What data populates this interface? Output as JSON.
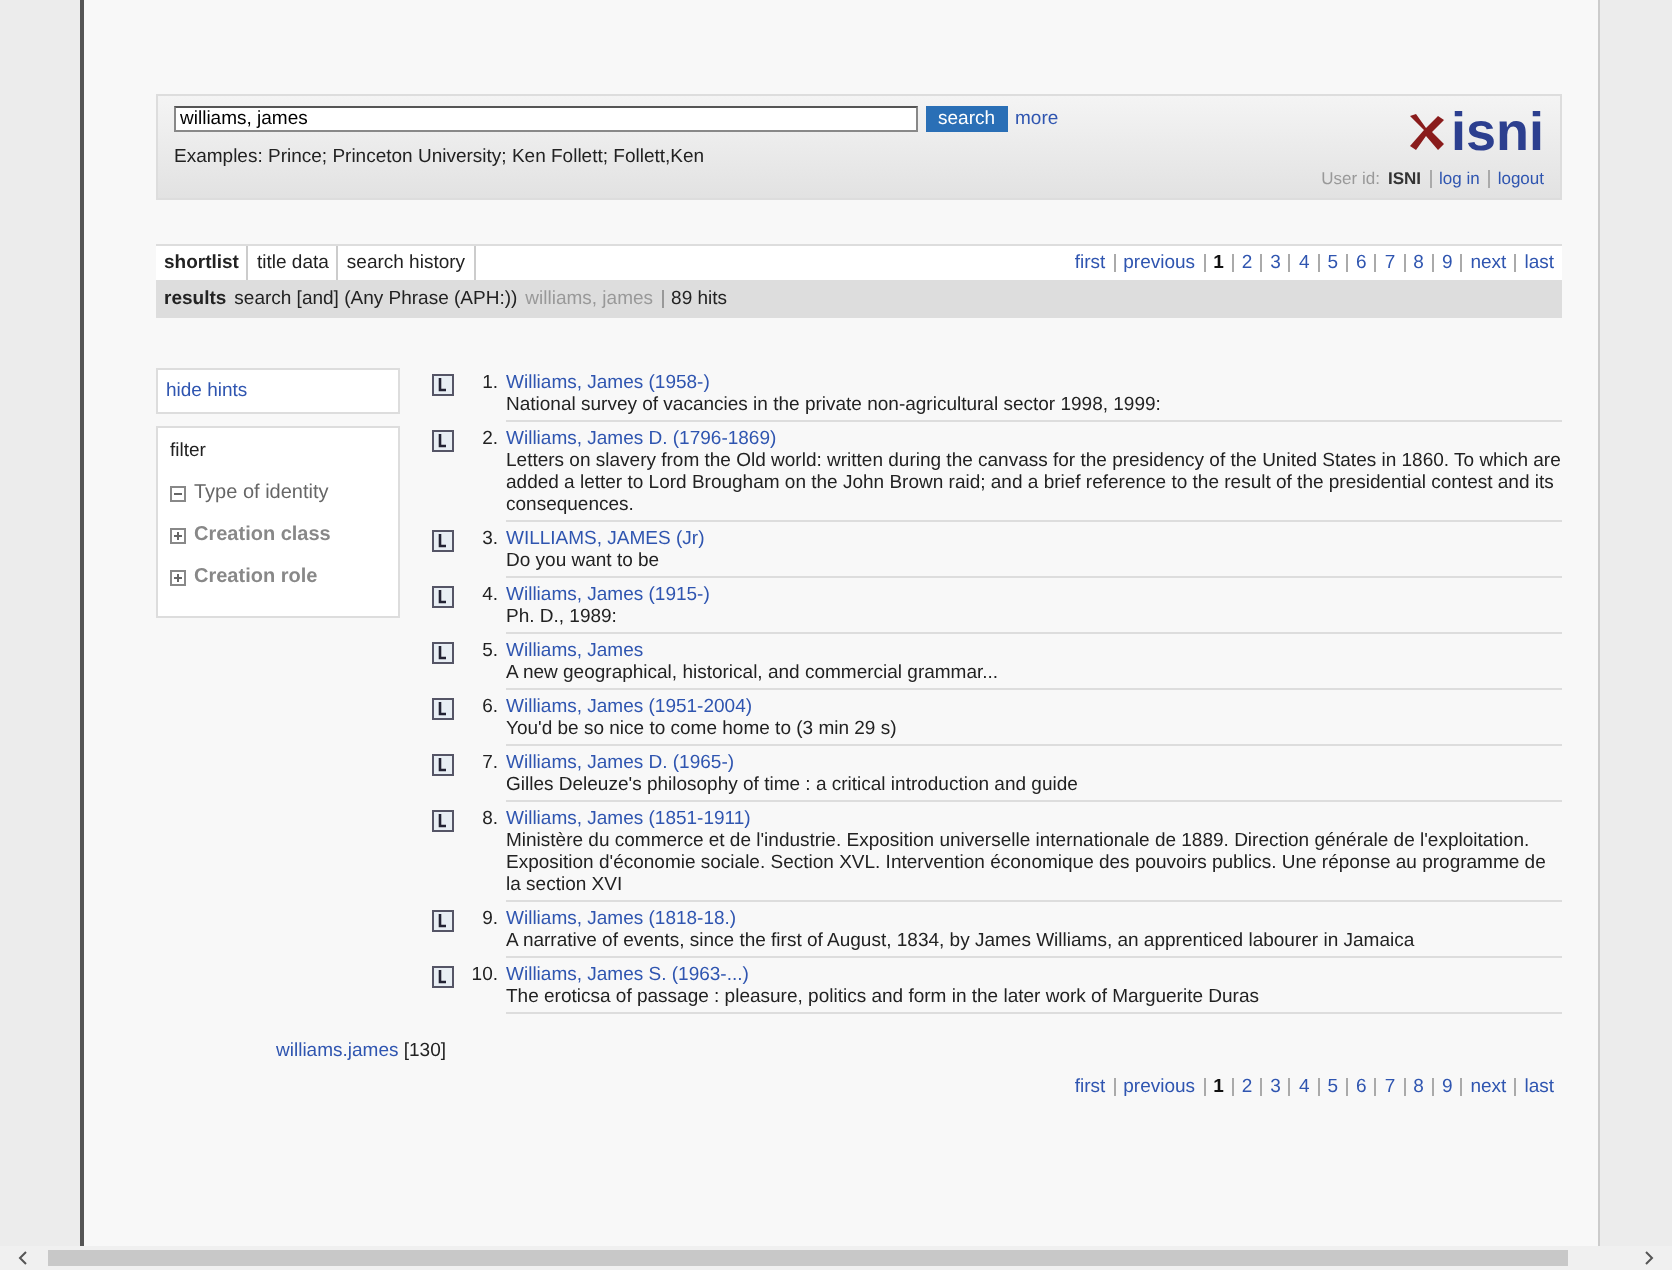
{
  "search": {
    "value": "williams, james",
    "button": "search",
    "more": "more",
    "examples": "Examples: Prince; Princeton University; Ken Follett; Follett,Ken"
  },
  "logo": {
    "text": "isni"
  },
  "user": {
    "label": "User id:",
    "id": "ISNI",
    "login": "log in",
    "logout": "logout"
  },
  "tabs": [
    {
      "label": "shortlist",
      "selected": true
    },
    {
      "label": "title data",
      "selected": false
    },
    {
      "label": "search history",
      "selected": false
    }
  ],
  "pager_top": [
    {
      "label": "first",
      "selected": false
    },
    {
      "label": "previous",
      "selected": false
    },
    {
      "label": "1",
      "selected": true
    },
    {
      "label": "2",
      "selected": false
    },
    {
      "label": "3",
      "selected": false
    },
    {
      "label": "4",
      "selected": false
    },
    {
      "label": "5",
      "selected": false
    },
    {
      "label": "6",
      "selected": false
    },
    {
      "label": "7",
      "selected": false
    },
    {
      "label": "8",
      "selected": false
    },
    {
      "label": "9",
      "selected": false
    },
    {
      "label": "next",
      "selected": false
    },
    {
      "label": "last",
      "selected": false
    }
  ],
  "results_bar": {
    "label": "results",
    "query": "search [and] (Any Phrase (APH:))",
    "term": "williams, james",
    "hits": "89 hits"
  },
  "sidebar": {
    "hide_hints": "hide hints",
    "filter_title": "filter",
    "filters": [
      {
        "label": "Type of identity",
        "expanded": true
      },
      {
        "label": "Creation class",
        "expanded": false
      },
      {
        "label": "Creation role",
        "expanded": false
      }
    ]
  },
  "results": [
    {
      "number": "1.",
      "name": "Williams, James (1958-)",
      "title": "National survey of vacancies in the private non-agricultural sector 1998, 1999:"
    },
    {
      "number": "2.",
      "name": "Williams, James D. (1796-1869)",
      "title": "Letters on slavery from the Old world: written during the canvass for the presidency of the United States in 1860. To which are added a letter to Lord Brougham on the John Brown raid; and a brief reference to the result of the presidential contest and its consequences."
    },
    {
      "number": "3.",
      "name": "WILLIAMS, JAMES (Jr)",
      "title": "Do you want to be"
    },
    {
      "number": "4.",
      "name": "Williams, James (1915-)",
      "title": "Ph. D., 1989:"
    },
    {
      "number": "5.",
      "name": "Williams, James",
      "title": "A new geographical, historical, and commercial grammar..."
    },
    {
      "number": "6.",
      "name": "Williams, James (1951-2004)",
      "title": "You'd be so nice to come home to (3 min 29 s)"
    },
    {
      "number": "7.",
      "name": "Williams, James D. (1965-)",
      "title": "Gilles Deleuze's philosophy of time : a critical introduction and guide"
    },
    {
      "number": "8.",
      "name": "Williams, James (1851-1911)",
      "title": "Ministère du commerce et de l'industrie. Exposition universelle internationale de 1889. Direction générale de l'exploitation. Exposition d'économie sociale. Section XVL. Intervention économique des pouvoirs publics. Une réponse au programme de la section XVI"
    },
    {
      "number": "9.",
      "name": "Williams, James (1818-18.)",
      "title": "A narrative of events, since the first of August, 1834, by James Williams, an apprenticed labourer in Jamaica"
    },
    {
      "number": "10.",
      "name": "Williams, James S. (1963-...)",
      "title": "The eroticsa of passage : pleasure, politics and form in the later work of Marguerite Duras"
    }
  ],
  "related": {
    "link": "williams.james",
    "count": "[130]"
  },
  "pager_bottom": [
    {
      "label": "first",
      "selected": false
    },
    {
      "label": "previous",
      "selected": false
    },
    {
      "label": "1",
      "selected": true
    },
    {
      "label": "2",
      "selected": false
    },
    {
      "label": "3",
      "selected": false
    },
    {
      "label": "4",
      "selected": false
    },
    {
      "label": "5",
      "selected": false
    },
    {
      "label": "6",
      "selected": false
    },
    {
      "label": "7",
      "selected": false
    },
    {
      "label": "8",
      "selected": false
    },
    {
      "label": "9",
      "selected": false
    },
    {
      "label": "next",
      "selected": false
    },
    {
      "label": "last",
      "selected": false
    }
  ]
}
